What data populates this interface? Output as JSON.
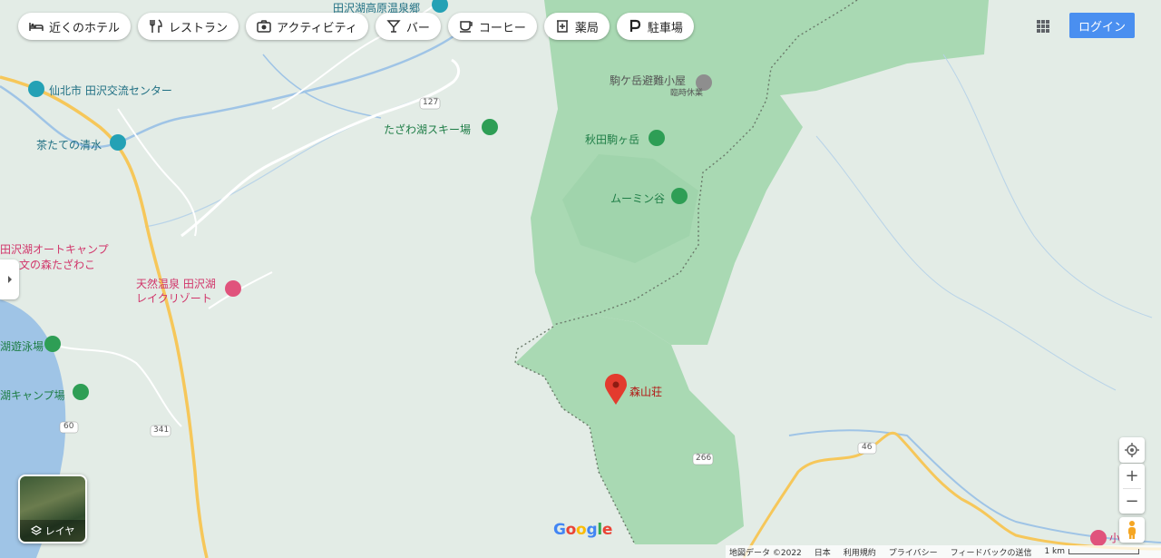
{
  "filters": [
    {
      "label": "近くのホテル",
      "icon": "hotel-icon"
    },
    {
      "label": "レストラン",
      "icon": "restaurant-icon"
    },
    {
      "label": "アクティビティ",
      "icon": "camera-icon"
    },
    {
      "label": "バー",
      "icon": "bar-icon"
    },
    {
      "label": "コーヒー",
      "icon": "coffee-icon"
    },
    {
      "label": "薬局",
      "icon": "pharmacy-icon"
    },
    {
      "label": "駐車場",
      "icon": "parking-icon"
    }
  ],
  "header": {
    "login_label": "ログイン"
  },
  "layers": {
    "label": "レイヤ"
  },
  "places": {
    "top_spa": "田沢湖高原温泉郷",
    "kouryu": "仙北市 田沢交流センター",
    "ski": "たざわ湖スキー場",
    "komagatake_hut": "駒ケ岳避難小屋",
    "komagatake_hut_status": "臨時休業",
    "akita_komagatake": "秋田駒ヶ岳",
    "moomin": "ムーミン谷",
    "shimizu": "茶たての清水",
    "autocamp_1": "田沢湖オートキャンプ",
    "autocamp_2": "文の森たざわこ",
    "onsen_1": "天然温泉 田沢湖",
    "onsen_2": "レイクリゾート",
    "swim": "湖遊泳場",
    "camp": "湖キャンプ場",
    "selected": "森山荘",
    "bottom_right": "小"
  },
  "roads": [
    "127",
    "341",
    "60",
    "266",
    "46"
  ],
  "footer": {
    "map_data": "地図データ ©2022",
    "country": "日本",
    "terms": "利用規約",
    "privacy": "プライバシー",
    "feedback": "フィードバックの送信",
    "scale": "1 km"
  },
  "brand": {
    "logo": "Google"
  },
  "colors": {
    "park": "#a8d8af",
    "water": "#9fc4e6",
    "road_yellow": "#f6c75a",
    "accent": "#4a8ff0"
  }
}
